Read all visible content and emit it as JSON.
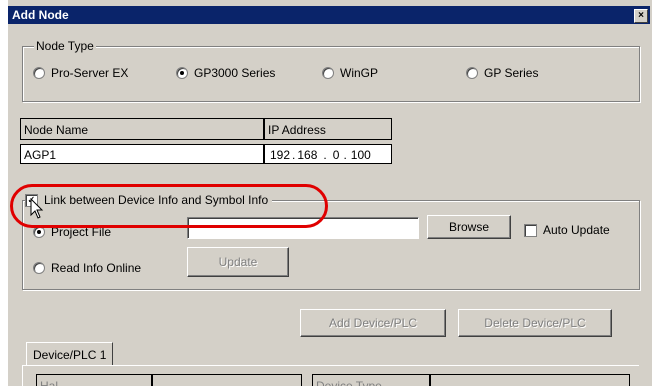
{
  "window": {
    "title": "Add Node",
    "close_glyph": "×"
  },
  "node_type": {
    "legend": "Node Type",
    "options": [
      {
        "label": "Pro-Server EX",
        "selected": false
      },
      {
        "label": "GP3000 Series",
        "selected": true
      },
      {
        "label": "WinGP",
        "selected": false
      },
      {
        "label": "GP Series",
        "selected": false
      }
    ]
  },
  "node_table": {
    "headers": [
      "Node Name",
      "IP Address"
    ],
    "node_name_value": "AGP1",
    "ip": [
      "192",
      "168",
      "0",
      "100"
    ],
    "ip_separator": "."
  },
  "link_section": {
    "checkbox_label": "Link between Device Info and Symbol Info",
    "checked": true,
    "project_file_label": "Project File",
    "project_file_value": "",
    "browse_label": "Browse",
    "auto_update_label": "Auto Update",
    "read_online_label": "Read Info Online",
    "update_label": "Update"
  },
  "device_buttons": {
    "add_label": "Add Device/PLC",
    "delete_label": "Delete Device/PLC"
  },
  "tabs": [
    {
      "label": "Device/PLC 1"
    }
  ],
  "bottom_headers": [
    "Hal",
    "Device Type"
  ],
  "colors": {
    "title_bar": "#0a246a",
    "highlight": "#e00000",
    "dialog_bg": "#d4d0c8"
  },
  "icons": [
    "close-icon",
    "mouse-cursor-icon"
  ]
}
